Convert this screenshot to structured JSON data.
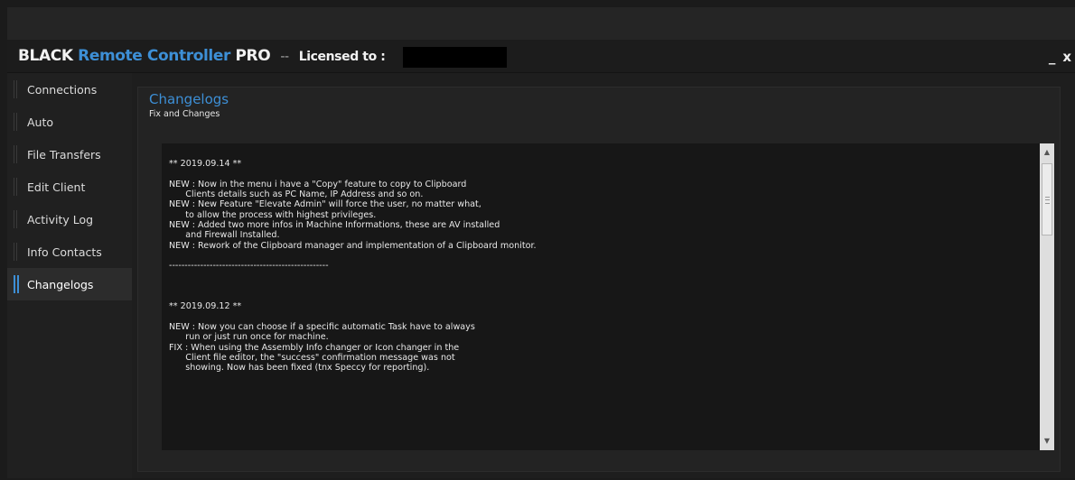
{
  "window": {
    "title_black": "BLACK",
    "title_remote": "Remote Controller",
    "title_pro": "PRO",
    "title_separator": "--",
    "licensed_label": "Licensed to :",
    "minimize_label": "_",
    "close_label": "x"
  },
  "sidebar": {
    "items": [
      {
        "label": "Connections"
      },
      {
        "label": "Auto"
      },
      {
        "label": "File Transfers"
      },
      {
        "label": "Edit Client"
      },
      {
        "label": "Activity Log"
      },
      {
        "label": "Info Contacts"
      },
      {
        "label": "Changelogs"
      }
    ],
    "active": "Changelogs"
  },
  "page": {
    "title": "Changelogs",
    "subtitle": "Fix and Changes",
    "log_text": "\n** 2019.09.14 **\n\nNEW : Now in the menu i have a \"Copy\" feature to copy to Clipboard\n      Clients details such as PC Name, IP Address and so on.\nNEW : New Feature \"Elevate Admin\" will force the user, no matter what,\n      to allow the process with highest privileges.\nNEW : Added two more infos in Machine Informations, these are AV installed\n      and Firewall Installed.\nNEW : Rework of the Clipboard manager and implementation of a Clipboard monitor.\n\n---------------------------------------------------\n\n\n\n** 2019.09.12 **\n\nNEW : Now you can choose if a specific automatic Task have to always\n      run or just run once for machine.\nFIX : When using the Assembly Info changer or Icon changer in the\n      Client file editor, the \"success\" confirmation message was not\n      showing. Now has been fixed (tnx Speccy for reporting)."
  },
  "scrollbar": {
    "up_icon": "▲",
    "down_icon": "▼"
  },
  "colors": {
    "accent": "#3d8fd6",
    "background": "#1e1e1e",
    "text": "#e8e8e8"
  }
}
